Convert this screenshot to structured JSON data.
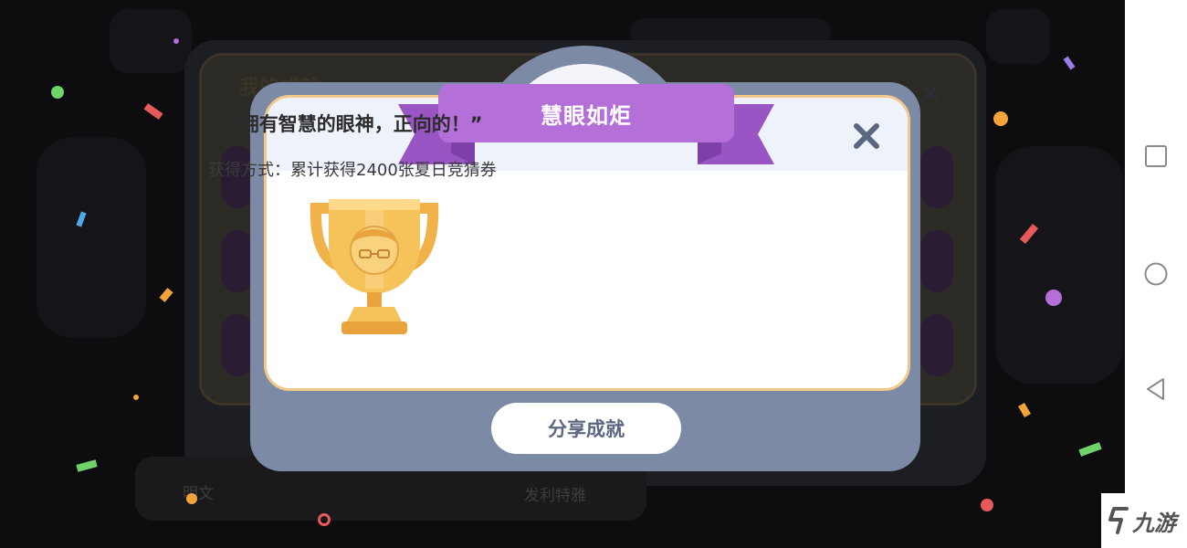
{
  "background": {
    "panel_title": "我的成就",
    "tab_left": "明文",
    "tab_right": "发利特雅"
  },
  "modal": {
    "banner_title": "慧眼如炬",
    "quote": "“你拥有智慧的眼神，正向的！”",
    "method": "获得方式：累计获得2400张夏日竞猜券",
    "share_label": "分享成就",
    "close_icon": "close-icon",
    "trophy_icon": "trophy-icon",
    "colors": {
      "ribbon": "#b56fd9",
      "ribbon_dark": "#9a55c4",
      "modal_frame": "#7d8aa6",
      "card_border": "#f2c88b",
      "share_text": "#5b6680"
    }
  },
  "navbar": {
    "items": [
      {
        "name": "recent-apps-icon"
      },
      {
        "name": "home-icon"
      },
      {
        "name": "back-icon"
      }
    ]
  },
  "watermark": {
    "text": "九游"
  }
}
